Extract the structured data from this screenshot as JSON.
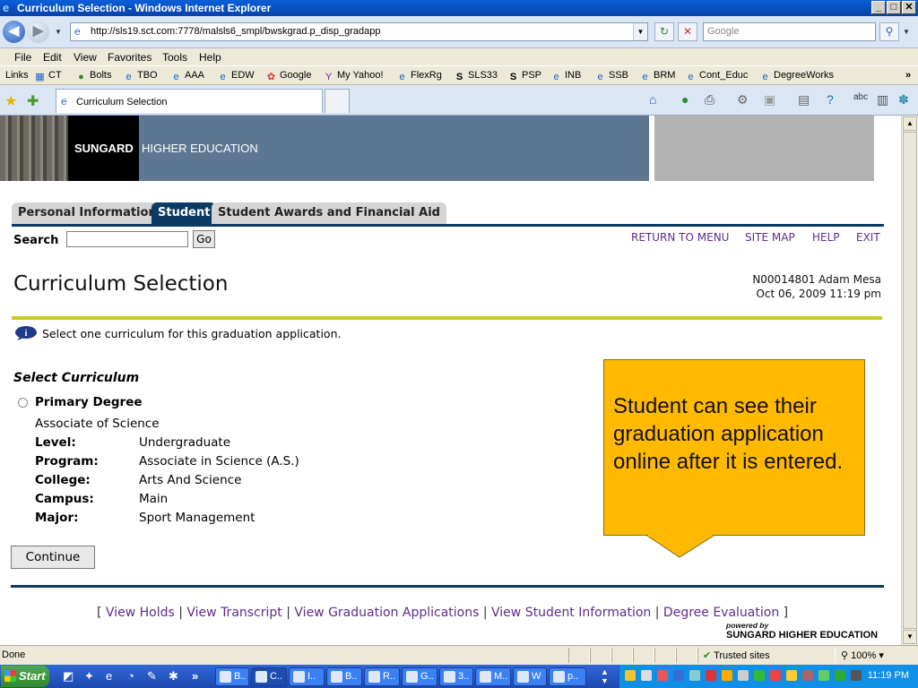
{
  "window": {
    "title": "Curriculum Selection - Windows Internet Explorer"
  },
  "browser": {
    "url": "http://sls19.sct.com:7778/malsls6_smpl/bwskgrad.p_disp_gradapp",
    "search_placeholder": "Google",
    "menu": [
      "File",
      "Edit",
      "View",
      "Favorites",
      "Tools",
      "Help"
    ],
    "links_label": "Links",
    "links": [
      "CT",
      "Bolts",
      "TBO",
      "AAA",
      "EDW",
      "Google",
      "My Yahoo!",
      "FlexRg",
      "SLS33",
      "PSP",
      "INB",
      "SSB",
      "BRM",
      "Cont_Educ",
      "DegreeWorks"
    ],
    "tab_title": "Curriculum Selection"
  },
  "banner": {
    "brand": "SUNGARD",
    "tagline": "HIGHER EDUCATION"
  },
  "nav_tabs": [
    "Personal Information",
    "Student",
    "Student Awards and Financial Aid"
  ],
  "search": {
    "label": "Search",
    "button": "Go"
  },
  "top_links": [
    "RETURN TO MENU",
    "SITE MAP",
    "HELP",
    "EXIT"
  ],
  "page": {
    "title": "Curriculum Selection",
    "student_id_name": "N00014801 Adam Mesa",
    "datetime": "Oct 06, 2009 11:19 pm",
    "info": "Select one curriculum for this graduation application.",
    "section_heading": "Select Curriculum",
    "option_label": "Primary Degree",
    "degree": "Associate of Science",
    "fields": [
      {
        "label": "Level:",
        "value": "Undergraduate"
      },
      {
        "label": "Program:",
        "value": "Associate in Science (A.S.)"
      },
      {
        "label": "College:",
        "value": "Arts And Science"
      },
      {
        "label": "Campus:",
        "value": "Main"
      },
      {
        "label": "Major:",
        "value": "Sport Management"
      }
    ],
    "continue_button": "Continue"
  },
  "footer": {
    "links": [
      "View Holds",
      "View Transcript",
      "View Graduation Applications",
      "View Student Information",
      "Degree Evaluation"
    ],
    "powered_by": "powered by",
    "powered_brand": "SUNGARD HIGHER EDUCATION"
  },
  "callout": {
    "text": "Student can see their graduation application online after it is entered.",
    "color": "#ffba00"
  },
  "status": {
    "text": "Done",
    "zone": "Trusted sites",
    "zoom": "100%"
  },
  "taskbar": {
    "start": "Start",
    "buttons": [
      "B..",
      "C..",
      "I..",
      "B..",
      "R..",
      "G..",
      "3..",
      "M..",
      "W",
      "p.."
    ],
    "clock": "11:19 PM"
  }
}
